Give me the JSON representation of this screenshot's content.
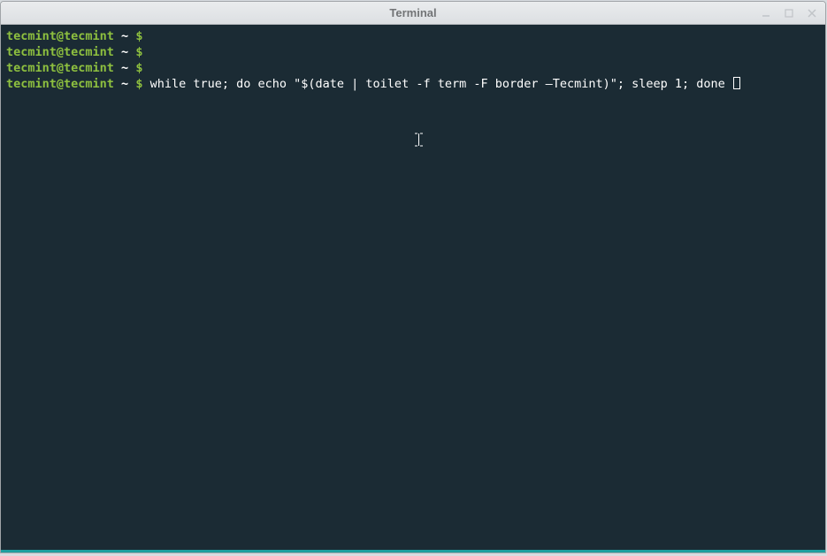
{
  "window": {
    "title": "Terminal"
  },
  "terminal": {
    "prompt_user": "tecmint@tecmint",
    "prompt_sep": " ~ ",
    "prompt_dollar": "$",
    "lines": [
      {
        "command": ""
      },
      {
        "command": ""
      },
      {
        "command": ""
      },
      {
        "command": "while true; do echo \"$(date | toilet -f term -F border —Tecmint)\"; sleep 1; done "
      }
    ]
  }
}
